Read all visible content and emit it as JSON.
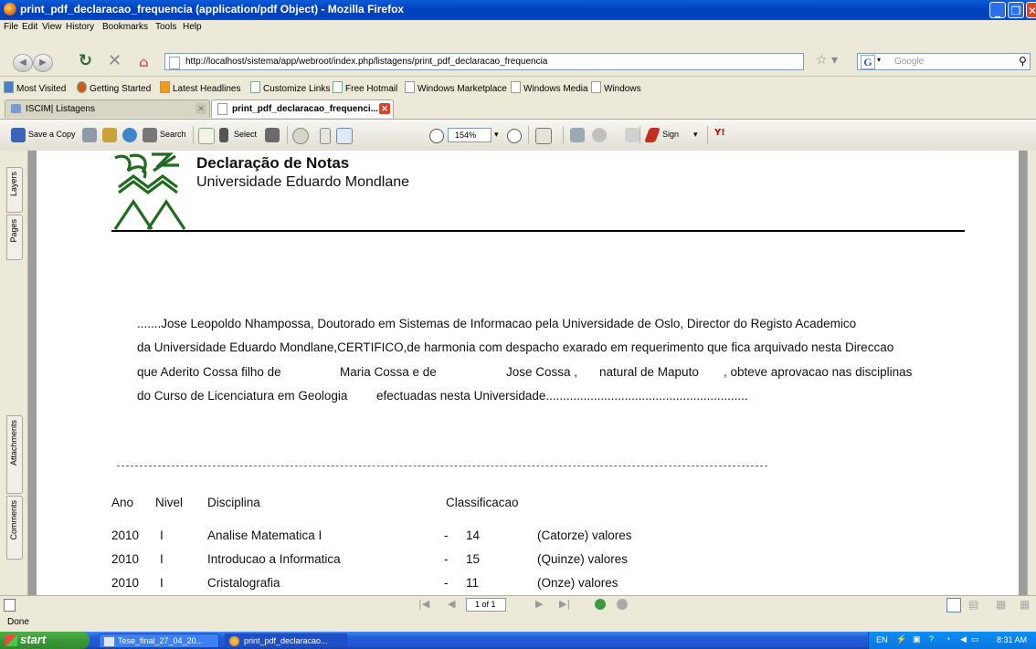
{
  "window": {
    "title": "print_pdf_declaracao_frequencia (application/pdf Object) - Mozilla Firefox"
  },
  "menu": [
    "File",
    "Edit",
    "View",
    "History",
    "Bookmarks",
    "Tools",
    "Help"
  ],
  "navigation": {
    "url": "http://localhost/sistema/app/webroot/index.php/listagens/print_pdf_declaracao_frequencia",
    "search_placeholder": "Google"
  },
  "bookmarks": [
    "Most Visited",
    "Getting Started",
    "Latest Headlines",
    "Customize Links",
    "Free Hotmail",
    "Windows Marketplace",
    "Windows Media",
    "Windows"
  ],
  "tabs": [
    {
      "label": "ISCIM| Listagens",
      "active": false
    },
    {
      "label": "print_pdf_declaracao_frequenci...",
      "active": true
    }
  ],
  "pdf_toolbar": {
    "save_copy": "Save a Copy",
    "search": "Search",
    "select": "Select",
    "zoom": "154%",
    "sign": "Sign"
  },
  "side_panel": {
    "tabs": [
      "Layers",
      "Pages",
      "Attachments",
      "Comments"
    ]
  },
  "document": {
    "title": "Declaração de Notas",
    "subtitle": "Universidade Eduardo Mondlane",
    "paragraph": {
      "line1": ".......Jose Leopoldo Nhampossa, Doutorado em Sistemas de Informacao pela Universidade de Oslo, Director do Registo Academico",
      "line2": "da Universidade Eduardo Mondlane,CERTIFICO,de harmonia com despacho exarado em requerimento que fica arquivado nesta Direccao",
      "line3_a": "que Aderito Cossa filho de",
      "line3_b": "Maria Cossa e de",
      "line3_c": "Jose Cossa ,",
      "line3_d": "natural de Maputo",
      "line3_e": ", obteve aprovacao nas disciplinas",
      "line4_a": "do Curso de Licenciatura em Geologia",
      "line4_b": "efectuadas nesta Universidade..........................................................."
    },
    "table": {
      "headers": {
        "ano": "Ano",
        "nivel": "Nivel",
        "disciplina": "Disciplina",
        "classificacao": "Classificacao"
      },
      "rows": [
        {
          "ano": "2010",
          "nivel": "I",
          "disciplina": "Analise Matematica I",
          "dash": "-",
          "nota": "14",
          "extenso": "(Catorze) valores"
        },
        {
          "ano": "2010",
          "nivel": "I",
          "disciplina": "Introducao a Informatica",
          "dash": "-",
          "nota": "15",
          "extenso": "(Quinze) valores"
        },
        {
          "ano": "2010",
          "nivel": "I",
          "disciplina": "Cristalografia",
          "dash": "-",
          "nota": "11",
          "extenso": "(Onze) valores"
        }
      ]
    }
  },
  "pdf_nav": {
    "page_indicator": "1 of 1"
  },
  "status": "Done",
  "taskbar": {
    "start": "start",
    "tasks": [
      "Tese_final_27_04_20...",
      "print_pdf_declaracao..."
    ],
    "language": "EN",
    "clock": "8:31 AM"
  },
  "colors": {
    "logo_green": "#1f6b1f",
    "titlebar_blue": "#0343c4"
  }
}
